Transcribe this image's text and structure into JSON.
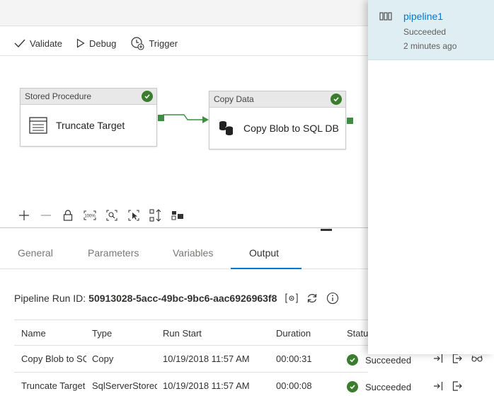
{
  "toolbar": {
    "validate_label": "Validate",
    "debug_label": "Debug",
    "trigger_label": "Trigger"
  },
  "activities": [
    {
      "category": "Stored Procedure",
      "name": "Truncate Target",
      "status": "success"
    },
    {
      "category": "Copy Data",
      "name": "Copy Blob to SQL DB",
      "status": "success"
    }
  ],
  "canvas_toolbar": {
    "icons": [
      "add-icon",
      "remove-icon",
      "lock-icon",
      "zoom-100-icon",
      "zoom-to-fit-icon",
      "select-icon",
      "auto-align-icon",
      "layout-icon"
    ]
  },
  "tabs": [
    {
      "label": "General",
      "active": false
    },
    {
      "label": "Parameters",
      "active": false
    },
    {
      "label": "Variables",
      "active": false
    },
    {
      "label": "Output",
      "active": true
    }
  ],
  "run": {
    "label": "Pipeline Run ID:",
    "id": "50913028-5acc-49bc-9bc6-aac6926963f8"
  },
  "table": {
    "columns": [
      "Name",
      "Type",
      "Run Start",
      "Duration",
      "Status"
    ],
    "rows": [
      {
        "name": "Copy Blob to SQL DB",
        "type": "Copy",
        "run_start": "10/19/2018 11:57 AM",
        "duration": "00:00:31",
        "status": "Succeeded"
      },
      {
        "name": "Truncate Target",
        "type": "SqlServerStoredProcedure",
        "run_start": "10/19/2018 11:57 AM",
        "duration": "00:00:08",
        "status": "Succeeded"
      }
    ]
  },
  "panel": {
    "pipeline_name": "pipeline1",
    "status": "Succeeded",
    "time": "2 minutes ago"
  },
  "colors": {
    "accent": "#0078d4",
    "success": "#3a7d2d",
    "connector": "#3e8e41"
  }
}
